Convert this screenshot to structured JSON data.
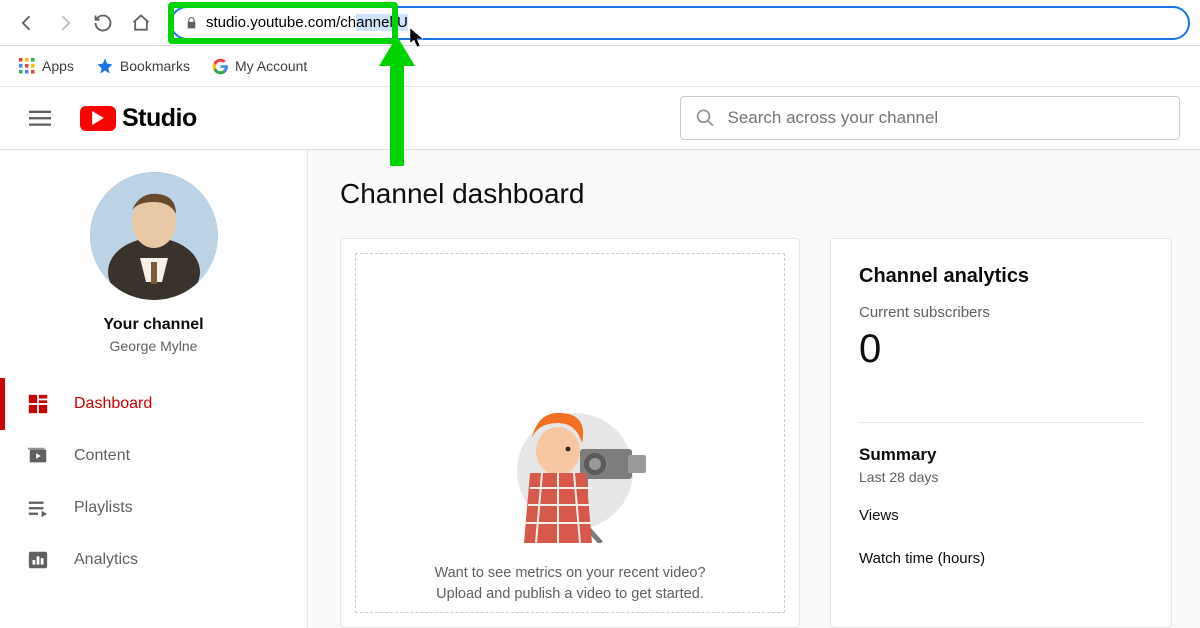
{
  "browser": {
    "url_plain": "studio.youtube.com/ch",
    "url_selected": "annel/U",
    "bookmarks": {
      "apps": "Apps",
      "bookmarks": "Bookmarks",
      "my_account": "My Account"
    }
  },
  "header": {
    "logo_text": "Studio",
    "search_placeholder": "Search across your channel"
  },
  "sidebar": {
    "your_channel_label": "Your channel",
    "channel_name": "George Mylne",
    "items": [
      {
        "label": "Dashboard"
      },
      {
        "label": "Content"
      },
      {
        "label": "Playlists"
      },
      {
        "label": "Analytics"
      }
    ]
  },
  "dashboard": {
    "title": "Channel dashboard",
    "prompt_line1": "Want to see metrics on your recent video?",
    "prompt_line2": "Upload and publish a video to get started.",
    "analytics": {
      "title": "Channel analytics",
      "subscribers_label": "Current subscribers",
      "subscribers_count": "0",
      "summary_title": "Summary",
      "summary_range": "Last 28 days",
      "metric_views": "Views",
      "metric_watch": "Watch time (hours)"
    }
  }
}
